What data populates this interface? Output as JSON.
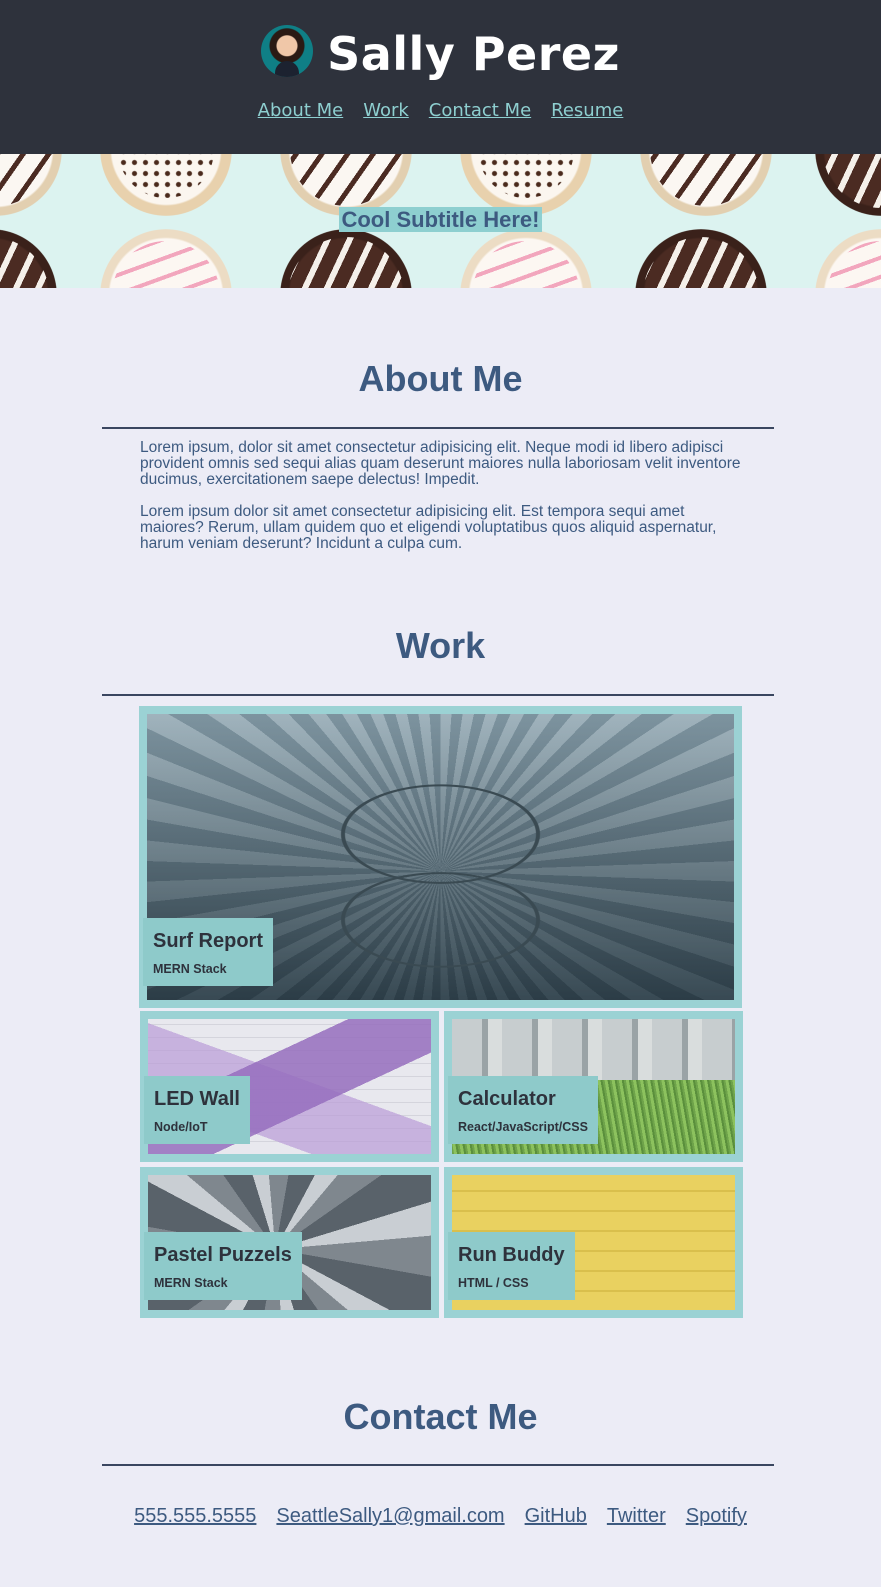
{
  "header": {
    "name": "Sally Perez",
    "nav": [
      "About Me",
      "Work",
      "Contact Me",
      "Resume"
    ]
  },
  "hero": {
    "subtitle": "Cool Subtitle Here!"
  },
  "about": {
    "title": "About Me",
    "paragraphs": [
      "Lorem ipsum, dolor sit amet consectetur adipisicing elit. Neque modi id libero adipisci provident omnis sed sequi alias quam deserunt maiores nulla laboriosam velit inventore ducimus, exercitationem saepe delectus! Impedit.",
      "Lorem ipsum dolor sit amet consectetur adipisicing elit. Est tempora sequi amet maiores? Rerum, ullam quidem quo et eligendi voluptatibus quos aliquid aspernatur, harum veniam deserunt? Incidunt a culpa cum."
    ]
  },
  "work": {
    "title": "Work",
    "projects": [
      {
        "title": "Surf Report",
        "subtitle": "MERN Stack"
      },
      {
        "title": "LED Wall",
        "subtitle": "Node/IoT"
      },
      {
        "title": "Calculator",
        "subtitle": "React/JavaScript/CSS"
      },
      {
        "title": "Pastel Puzzels",
        "subtitle": "MERN Stack"
      },
      {
        "title": "Run Buddy",
        "subtitle": "HTML / CSS"
      }
    ]
  },
  "contact": {
    "title": "Contact Me",
    "links": [
      "555.555.5555",
      "SeattleSally1@gmail.com",
      "GitHub",
      "Twitter",
      "Spotify"
    ]
  },
  "colors": {
    "header_bg": "#2e323c",
    "accent": "#8ecfd0",
    "text": "#3d5a80",
    "page_bg": "#ececf6"
  }
}
